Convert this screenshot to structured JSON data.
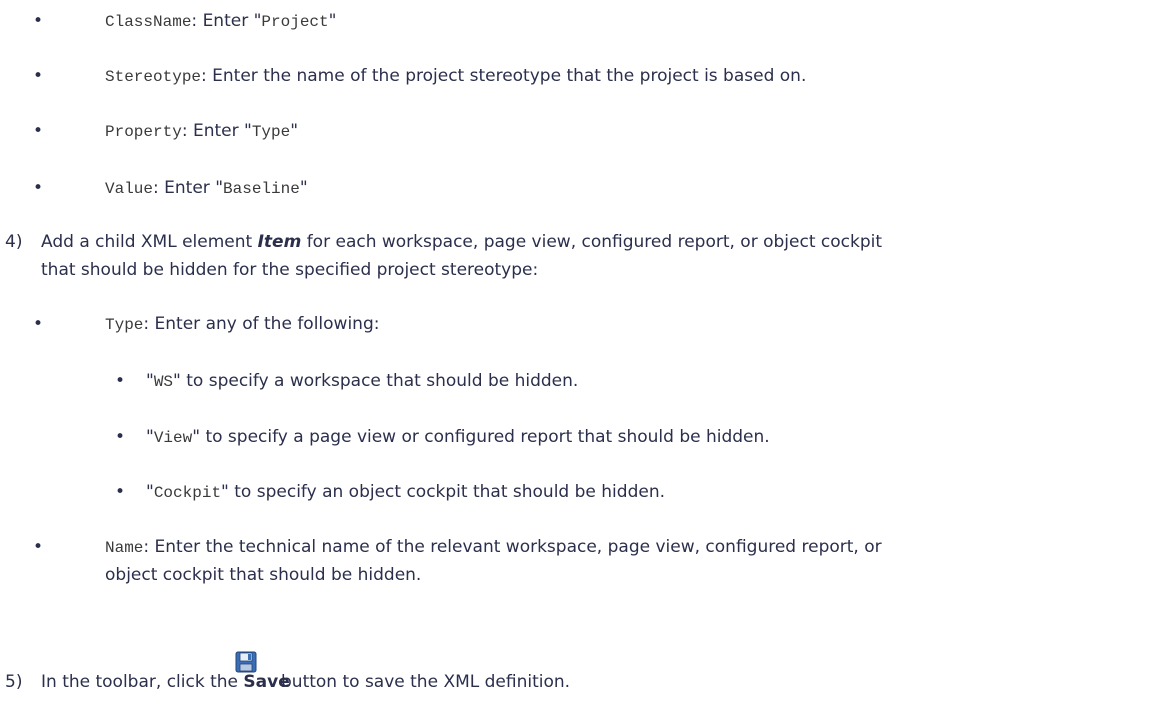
{
  "bullets_top": [
    {
      "code": "ClassName",
      "sep": ": ",
      "text1": "Enter \"",
      "code2": "Project",
      "text2": "\""
    },
    {
      "code": "Stereotype",
      "sep": ": ",
      "text1": "Enter the name of the project stereotype that the project is based on.",
      "code2": "",
      "text2": ""
    },
    {
      "code": "Property",
      "sep": ": ",
      "text1": "Enter \"",
      "code2": "Type",
      "text2": "\""
    },
    {
      "code": "Value",
      "sep": ": ",
      "text1": "Enter \"",
      "code2": "Baseline",
      "text2": "\""
    }
  ],
  "step4": {
    "number": "4)",
    "text_a": "Add a child XML element ",
    "emph": "Item",
    "text_b": " for each workspace, page view, configured report, or object cockpit",
    "line2": "that should be hidden for the specified project stereotype:"
  },
  "type_bullet": {
    "code": "Type",
    "text": ": Enter any of the following:"
  },
  "type_options": [
    {
      "q1": "\"",
      "code": "WS",
      "rest": "\" to specify a workspace that should be hidden."
    },
    {
      "q1": "\"",
      "code": "View",
      "rest": "\" to specify a page view or configured report that should be hidden."
    },
    {
      "q1": "\"",
      "code": "Cockpit",
      "rest": "\" to specify an object cockpit that should be hidden."
    }
  ],
  "name_bullet": {
    "code": "Name",
    "text": ": Enter the technical name of the relevant workspace, page view, configured report, or",
    "line2": "object cockpit that should be hidden."
  },
  "step5": {
    "number": "5)",
    "text_a": "In the toolbar, click the ",
    "bold": "Save",
    "text_b": "button to save the XML definition.",
    "icon": "save-icon"
  }
}
